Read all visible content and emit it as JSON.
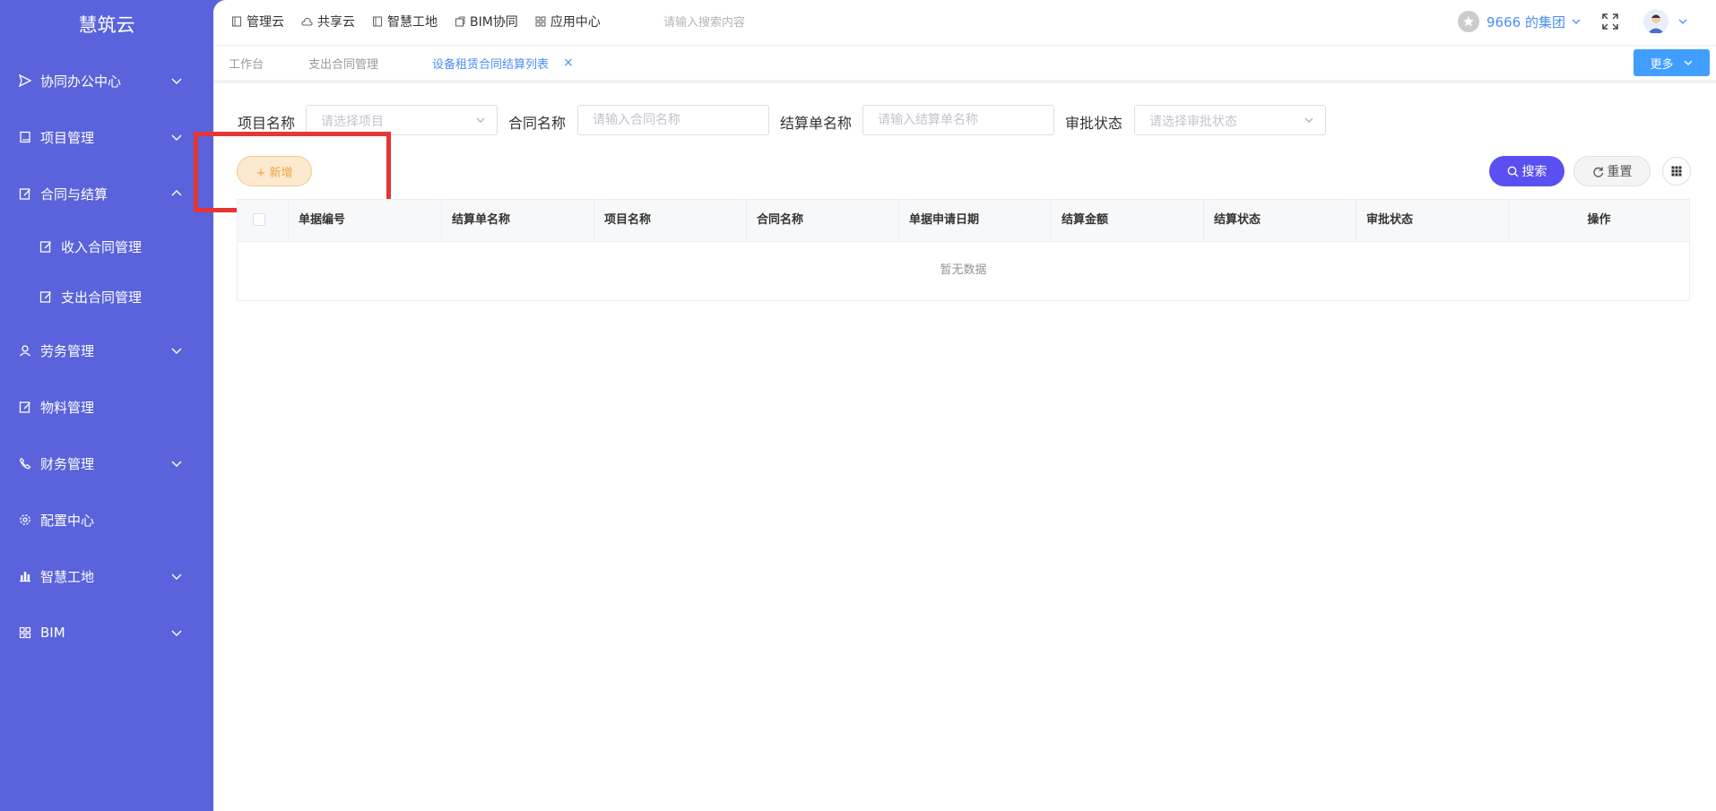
{
  "sidebar": {
    "logo": "慧筑云",
    "items": [
      {
        "label": "协同办公中心"
      },
      {
        "label": "项目管理"
      },
      {
        "label": "合同与结算"
      },
      {
        "label": "收入合同管理"
      },
      {
        "label": "支出合同管理"
      },
      {
        "label": "劳务管理"
      },
      {
        "label": "物料管理"
      },
      {
        "label": "财务管理"
      },
      {
        "label": "配置中心"
      },
      {
        "label": "智慧工地"
      },
      {
        "label": "BIM"
      }
    ]
  },
  "topbar": {
    "nav": [
      {
        "label": "管理云"
      },
      {
        "label": "共享云"
      },
      {
        "label": "智慧工地"
      },
      {
        "label": "BIM协同"
      },
      {
        "label": "应用中心"
      }
    ],
    "search_placeholder": "请输入搜索内容",
    "org_name": "9666 的集团"
  },
  "tabs": {
    "items": [
      {
        "label": "工作台"
      },
      {
        "label": "支出合同管理"
      },
      {
        "label": "设备租赁合同结算列表"
      }
    ],
    "close": "×",
    "more_label": "更多"
  },
  "filters": {
    "project_label": "项目名称",
    "project_placeholder": "请选择项目",
    "contract_label": "合同名称",
    "contract_placeholder": "请输入合同名称",
    "settlement_label": "结算单名称",
    "settlement_placeholder": "请输入结算单名称",
    "approval_label": "审批状态",
    "approval_placeholder": "请选择审批状态"
  },
  "actions": {
    "add_label": "+ 新增",
    "search_label": "搜索",
    "reset_label": "重置"
  },
  "table": {
    "columns": [
      "单据编号",
      "结算单名称",
      "项目名称",
      "合同名称",
      "单据申请日期",
      "结算金额",
      "结算状态",
      "审批状态",
      "操作"
    ],
    "empty_text": "暂无数据"
  },
  "colors": {
    "sidebar_bg": "#5a63db",
    "accent": "#4a8ef0",
    "primary_button": "#5a4ff0",
    "add_button": "#fde9cf",
    "highlight": "#e53535"
  }
}
